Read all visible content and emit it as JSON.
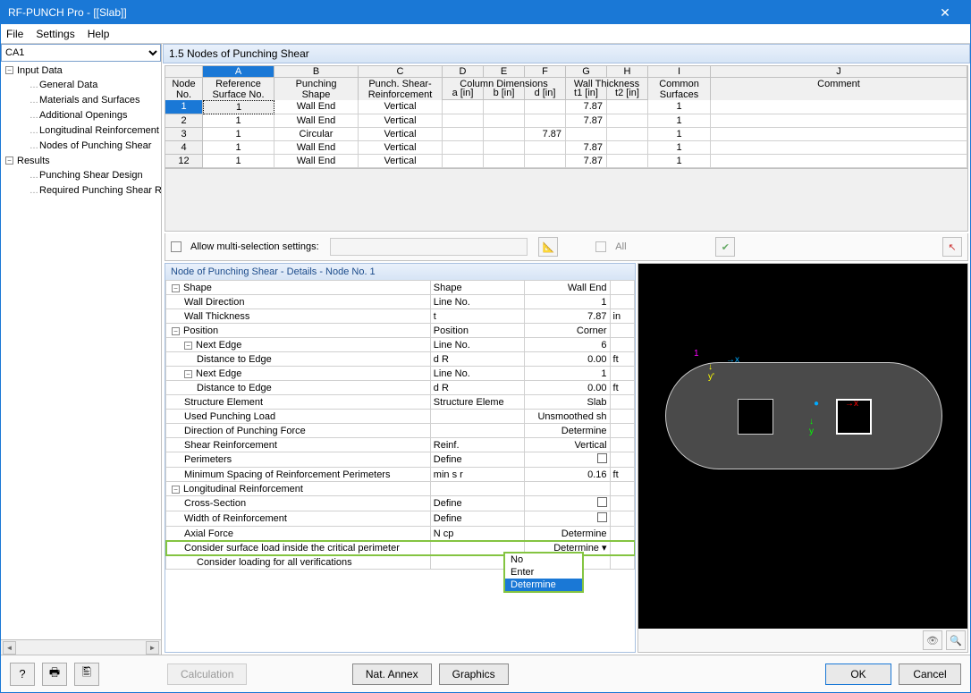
{
  "window": {
    "title": "RF-PUNCH Pro - [[Slab]]"
  },
  "menu": {
    "file": "File",
    "settings": "Settings",
    "help": "Help"
  },
  "sidebar": {
    "case": "CA1",
    "input_data": "Input Data",
    "items": [
      "General Data",
      "Materials and Surfaces",
      "Additional Openings",
      "Longitudinal Reinforcement",
      "Nodes of Punching Shear"
    ],
    "results": "Results",
    "result_items": [
      "Punching Shear Design",
      "Required Punching Shear Reinf"
    ]
  },
  "panel": {
    "title": "1.5 Nodes of Punching Shear"
  },
  "grid": {
    "letters": [
      "A",
      "B",
      "C",
      "D",
      "E",
      "F",
      "G",
      "H",
      "I",
      "J"
    ],
    "head1": {
      "node_no": "Node\nNo.",
      "ref": "Reference\nSurface No.",
      "shape": "Punching\nShape",
      "reinf": "Punch. Shear-\nReinforcement",
      "coldim": "Column Dimensions",
      "wallth": "Wall Thickness",
      "common": "Common\nSurfaces",
      "comment": "Comment"
    },
    "sub": {
      "a": "a [in]",
      "b": "b [in]",
      "d": "d [in]",
      "t1": "t1 [in]",
      "t2": "t2 [in]"
    },
    "rows": [
      {
        "no": "1",
        "ref": "1",
        "shape": "Wall End",
        "reinf": "Vertical",
        "a": "",
        "b": "",
        "d": "",
        "t1": "7.87",
        "t2": "",
        "common": "1",
        "comment": ""
      },
      {
        "no": "2",
        "ref": "1",
        "shape": "Wall End",
        "reinf": "Vertical",
        "a": "",
        "b": "",
        "d": "",
        "t1": "7.87",
        "t2": "",
        "common": "1",
        "comment": ""
      },
      {
        "no": "3",
        "ref": "1",
        "shape": "Circular",
        "reinf": "Vertical",
        "a": "",
        "b": "",
        "d": "7.87",
        "t1": "",
        "t2": "",
        "common": "1",
        "comment": ""
      },
      {
        "no": "4",
        "ref": "1",
        "shape": "Wall End",
        "reinf": "Vertical",
        "a": "",
        "b": "",
        "d": "",
        "t1": "7.87",
        "t2": "",
        "common": "1",
        "comment": ""
      },
      {
        "no": "12",
        "ref": "1",
        "shape": "Wall End",
        "reinf": "Vertical",
        "a": "",
        "b": "",
        "d": "",
        "t1": "7.87",
        "t2": "",
        "common": "1",
        "comment": ""
      }
    ]
  },
  "toolbar": {
    "allow_multi": "Allow multi-selection settings:",
    "all": "All"
  },
  "details": {
    "title": "Node of Punching Shear - Details - Node No.  1",
    "rows": [
      {
        "type": "group",
        "toggle": "-",
        "label": "Shape",
        "c2": "Shape",
        "c3": "Wall End",
        "c4": ""
      },
      {
        "type": "item",
        "indent": 1,
        "label": "Wall Direction",
        "c2": "Line No.",
        "c3": "1",
        "c4": ""
      },
      {
        "type": "item",
        "indent": 1,
        "label": "Wall Thickness",
        "c2": "t",
        "c3": "7.87",
        "c4": "in"
      },
      {
        "type": "group",
        "toggle": "-",
        "label": "Position",
        "c2": "Position",
        "c3": "Corner",
        "c4": ""
      },
      {
        "type": "sub",
        "toggle": "-",
        "indent": 1,
        "label": "Next Edge",
        "c2": "Line No.",
        "c3": "6",
        "c4": ""
      },
      {
        "type": "item",
        "indent": 2,
        "label": "Distance to Edge",
        "c2": "d R",
        "c3": "0.00",
        "c4": "ft"
      },
      {
        "type": "sub",
        "toggle": "-",
        "indent": 1,
        "label": "Next Edge",
        "c2": "Line No.",
        "c3": "1",
        "c4": ""
      },
      {
        "type": "item",
        "indent": 2,
        "label": "Distance to Edge",
        "c2": "d R",
        "c3": "0.00",
        "c4": "ft"
      },
      {
        "type": "item",
        "indent": 1,
        "label": "Structure Element",
        "c2": "Structure Eleme",
        "c3": "Slab",
        "c4": ""
      },
      {
        "type": "item",
        "indent": 1,
        "label": "Used Punching Load",
        "c2": "",
        "c3": "Unsmoothed sh",
        "c4": ""
      },
      {
        "type": "item",
        "indent": 1,
        "label": "Direction of Punching Force",
        "c2": "",
        "c3": "Determine",
        "c4": ""
      },
      {
        "type": "item",
        "indent": 1,
        "label": "Shear Reinforcement",
        "c2": "Reinf.",
        "c3": "Vertical",
        "c4": ""
      },
      {
        "type": "item",
        "indent": 1,
        "label": "Perimeters",
        "c2": "Define",
        "c3": "[chk]",
        "c4": ""
      },
      {
        "type": "item",
        "indent": 1,
        "label": "Minimum Spacing of Reinforcement Perimeters",
        "c2": "min s r",
        "c3": "0.16",
        "c4": "ft"
      },
      {
        "type": "group",
        "toggle": "-",
        "label": "Longitudinal Reinforcement",
        "c2": "",
        "c3": "",
        "c4": ""
      },
      {
        "type": "item",
        "indent": 1,
        "label": "Cross-Section",
        "c2": "Define",
        "c3": "[chk]",
        "c4": ""
      },
      {
        "type": "item",
        "indent": 1,
        "label": "Width of Reinforcement",
        "c2": "Define",
        "c3": "[chk]",
        "c4": ""
      },
      {
        "type": "item",
        "indent": 1,
        "label": "Axial Force",
        "c2": "N cp",
        "c3": "Determine",
        "c4": ""
      },
      {
        "type": "item",
        "indent": 1,
        "label": "Consider surface load inside the critical perimeter",
        "c2": "",
        "c3": "Determine ▾",
        "c4": "",
        "hl": true
      },
      {
        "type": "item",
        "indent": 2,
        "label": "Consider loading for all verifications",
        "c2": "",
        "c3": "",
        "c4": ""
      }
    ],
    "dropdown": {
      "options": [
        "No",
        "Enter",
        "Determine"
      ],
      "selected": "Determine"
    }
  },
  "footer": {
    "calculation": "Calculation",
    "nat_annex": "Nat. Annex",
    "graphics": "Graphics",
    "ok": "OK",
    "cancel": "Cancel"
  }
}
